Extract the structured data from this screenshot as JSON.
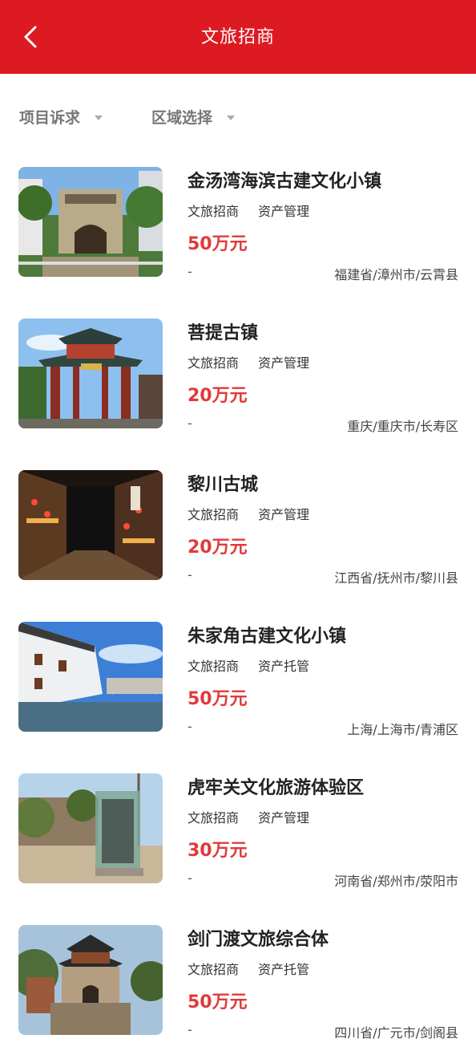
{
  "header": {
    "title": "文旅招商"
  },
  "filters": [
    {
      "label": "项目诉求"
    },
    {
      "label": "区域选择"
    }
  ],
  "items": [
    {
      "title": "金汤湾海滨古建文化小镇",
      "tags": [
        "文旅招商",
        "资产管理"
      ],
      "price": "50万元",
      "dash": "-",
      "region": "福建省/漳州市/云霄县"
    },
    {
      "title": "菩提古镇",
      "tags": [
        "文旅招商",
        "资产管理"
      ],
      "price": "20万元",
      "dash": "-",
      "region": "重庆/重庆市/长寿区"
    },
    {
      "title": "黎川古城",
      "tags": [
        "文旅招商",
        "资产管理"
      ],
      "price": "20万元",
      "dash": "-",
      "region": "江西省/抚州市/黎川县"
    },
    {
      "title": "朱家角古建文化小镇",
      "tags": [
        "文旅招商",
        "资产托管"
      ],
      "price": "50万元",
      "dash": "-",
      "region": "上海/上海市/青浦区"
    },
    {
      "title": "虎牢关文化旅游体验区",
      "tags": [
        "文旅招商",
        "资产管理"
      ],
      "price": "30万元",
      "dash": "-",
      "region": "河南省/郑州市/荥阳市"
    },
    {
      "title": "剑门渡文旅综合体",
      "tags": [
        "文旅招商",
        "资产托管"
      ],
      "price": "50万元",
      "dash": "-",
      "region": "四川省/广元市/剑阁县"
    }
  ],
  "theme": {
    "primary": "#dd1a22",
    "price": "#e03a3a"
  }
}
